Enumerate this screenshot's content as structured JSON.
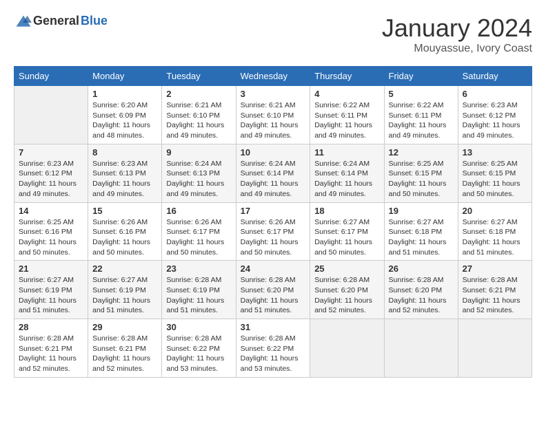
{
  "header": {
    "logo_general": "General",
    "logo_blue": "Blue",
    "month": "January 2024",
    "location": "Mouyassue, Ivory Coast"
  },
  "days_of_week": [
    "Sunday",
    "Monday",
    "Tuesday",
    "Wednesday",
    "Thursday",
    "Friday",
    "Saturday"
  ],
  "weeks": [
    [
      {
        "day": "",
        "empty": true
      },
      {
        "day": "1",
        "sunrise": "Sunrise: 6:20 AM",
        "sunset": "Sunset: 6:09 PM",
        "daylight": "Daylight: 11 hours and 48 minutes."
      },
      {
        "day": "2",
        "sunrise": "Sunrise: 6:21 AM",
        "sunset": "Sunset: 6:10 PM",
        "daylight": "Daylight: 11 hours and 49 minutes."
      },
      {
        "day": "3",
        "sunrise": "Sunrise: 6:21 AM",
        "sunset": "Sunset: 6:10 PM",
        "daylight": "Daylight: 11 hours and 49 minutes."
      },
      {
        "day": "4",
        "sunrise": "Sunrise: 6:22 AM",
        "sunset": "Sunset: 6:11 PM",
        "daylight": "Daylight: 11 hours and 49 minutes."
      },
      {
        "day": "5",
        "sunrise": "Sunrise: 6:22 AM",
        "sunset": "Sunset: 6:11 PM",
        "daylight": "Daylight: 11 hours and 49 minutes."
      },
      {
        "day": "6",
        "sunrise": "Sunrise: 6:23 AM",
        "sunset": "Sunset: 6:12 PM",
        "daylight": "Daylight: 11 hours and 49 minutes."
      }
    ],
    [
      {
        "day": "7",
        "sunrise": "Sunrise: 6:23 AM",
        "sunset": "Sunset: 6:12 PM",
        "daylight": "Daylight: 11 hours and 49 minutes."
      },
      {
        "day": "8",
        "sunrise": "Sunrise: 6:23 AM",
        "sunset": "Sunset: 6:13 PM",
        "daylight": "Daylight: 11 hours and 49 minutes."
      },
      {
        "day": "9",
        "sunrise": "Sunrise: 6:24 AM",
        "sunset": "Sunset: 6:13 PM",
        "daylight": "Daylight: 11 hours and 49 minutes."
      },
      {
        "day": "10",
        "sunrise": "Sunrise: 6:24 AM",
        "sunset": "Sunset: 6:14 PM",
        "daylight": "Daylight: 11 hours and 49 minutes."
      },
      {
        "day": "11",
        "sunrise": "Sunrise: 6:24 AM",
        "sunset": "Sunset: 6:14 PM",
        "daylight": "Daylight: 11 hours and 49 minutes."
      },
      {
        "day": "12",
        "sunrise": "Sunrise: 6:25 AM",
        "sunset": "Sunset: 6:15 PM",
        "daylight": "Daylight: 11 hours and 50 minutes."
      },
      {
        "day": "13",
        "sunrise": "Sunrise: 6:25 AM",
        "sunset": "Sunset: 6:15 PM",
        "daylight": "Daylight: 11 hours and 50 minutes."
      }
    ],
    [
      {
        "day": "14",
        "sunrise": "Sunrise: 6:25 AM",
        "sunset": "Sunset: 6:16 PM",
        "daylight": "Daylight: 11 hours and 50 minutes."
      },
      {
        "day": "15",
        "sunrise": "Sunrise: 6:26 AM",
        "sunset": "Sunset: 6:16 PM",
        "daylight": "Daylight: 11 hours and 50 minutes."
      },
      {
        "day": "16",
        "sunrise": "Sunrise: 6:26 AM",
        "sunset": "Sunset: 6:17 PM",
        "daylight": "Daylight: 11 hours and 50 minutes."
      },
      {
        "day": "17",
        "sunrise": "Sunrise: 6:26 AM",
        "sunset": "Sunset: 6:17 PM",
        "daylight": "Daylight: 11 hours and 50 minutes."
      },
      {
        "day": "18",
        "sunrise": "Sunrise: 6:27 AM",
        "sunset": "Sunset: 6:17 PM",
        "daylight": "Daylight: 11 hours and 50 minutes."
      },
      {
        "day": "19",
        "sunrise": "Sunrise: 6:27 AM",
        "sunset": "Sunset: 6:18 PM",
        "daylight": "Daylight: 11 hours and 51 minutes."
      },
      {
        "day": "20",
        "sunrise": "Sunrise: 6:27 AM",
        "sunset": "Sunset: 6:18 PM",
        "daylight": "Daylight: 11 hours and 51 minutes."
      }
    ],
    [
      {
        "day": "21",
        "sunrise": "Sunrise: 6:27 AM",
        "sunset": "Sunset: 6:19 PM",
        "daylight": "Daylight: 11 hours and 51 minutes."
      },
      {
        "day": "22",
        "sunrise": "Sunrise: 6:27 AM",
        "sunset": "Sunset: 6:19 PM",
        "daylight": "Daylight: 11 hours and 51 minutes."
      },
      {
        "day": "23",
        "sunrise": "Sunrise: 6:28 AM",
        "sunset": "Sunset: 6:19 PM",
        "daylight": "Daylight: 11 hours and 51 minutes."
      },
      {
        "day": "24",
        "sunrise": "Sunrise: 6:28 AM",
        "sunset": "Sunset: 6:20 PM",
        "daylight": "Daylight: 11 hours and 51 minutes."
      },
      {
        "day": "25",
        "sunrise": "Sunrise: 6:28 AM",
        "sunset": "Sunset: 6:20 PM",
        "daylight": "Daylight: 11 hours and 52 minutes."
      },
      {
        "day": "26",
        "sunrise": "Sunrise: 6:28 AM",
        "sunset": "Sunset: 6:20 PM",
        "daylight": "Daylight: 11 hours and 52 minutes."
      },
      {
        "day": "27",
        "sunrise": "Sunrise: 6:28 AM",
        "sunset": "Sunset: 6:21 PM",
        "daylight": "Daylight: 11 hours and 52 minutes."
      }
    ],
    [
      {
        "day": "28",
        "sunrise": "Sunrise: 6:28 AM",
        "sunset": "Sunset: 6:21 PM",
        "daylight": "Daylight: 11 hours and 52 minutes."
      },
      {
        "day": "29",
        "sunrise": "Sunrise: 6:28 AM",
        "sunset": "Sunset: 6:21 PM",
        "daylight": "Daylight: 11 hours and 52 minutes."
      },
      {
        "day": "30",
        "sunrise": "Sunrise: 6:28 AM",
        "sunset": "Sunset: 6:22 PM",
        "daylight": "Daylight: 11 hours and 53 minutes."
      },
      {
        "day": "31",
        "sunrise": "Sunrise: 6:28 AM",
        "sunset": "Sunset: 6:22 PM",
        "daylight": "Daylight: 11 hours and 53 minutes."
      },
      {
        "day": "",
        "empty": true
      },
      {
        "day": "",
        "empty": true
      },
      {
        "day": "",
        "empty": true
      }
    ]
  ]
}
